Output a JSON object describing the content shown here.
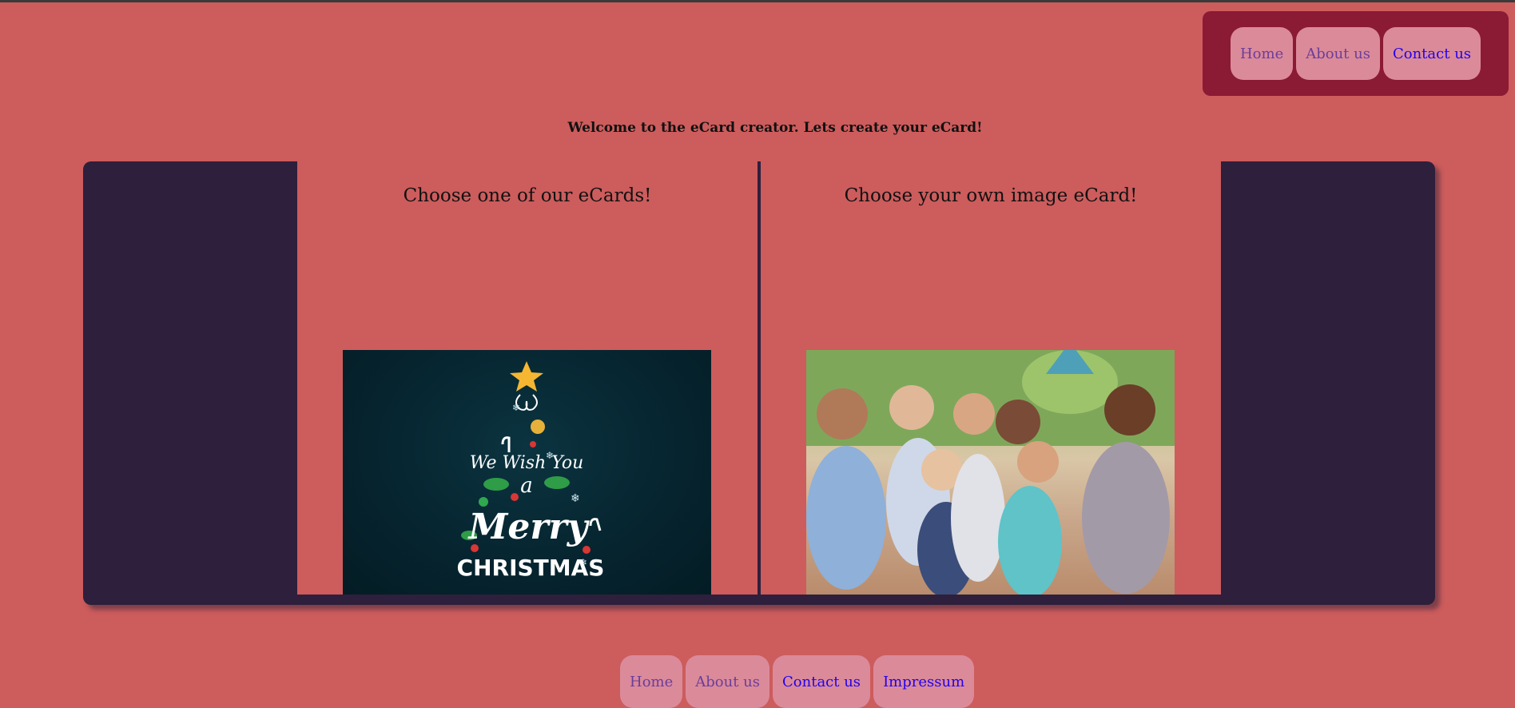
{
  "nav": {
    "home": "Home",
    "about": "About us",
    "contact": "Contact us"
  },
  "welcome": "Welcome to the eCard creator. Lets create your eCard!",
  "cards": {
    "left_title": "Choose one of our eCards!",
    "right_title": "Choose your own image eCard!",
    "left_image_text": {
      "line1": "We Wish You",
      "line2": "a",
      "line3": "Merry",
      "line4": "CHRISTMAS"
    }
  },
  "footer": {
    "home": "Home",
    "about": "About us",
    "contact": "Contact us",
    "impressum": "Impressum"
  },
  "colors": {
    "background": "#cd5c5c",
    "panel": "#2e1f3c",
    "topnav": "#8b1a35",
    "button": "#db8a9a"
  }
}
